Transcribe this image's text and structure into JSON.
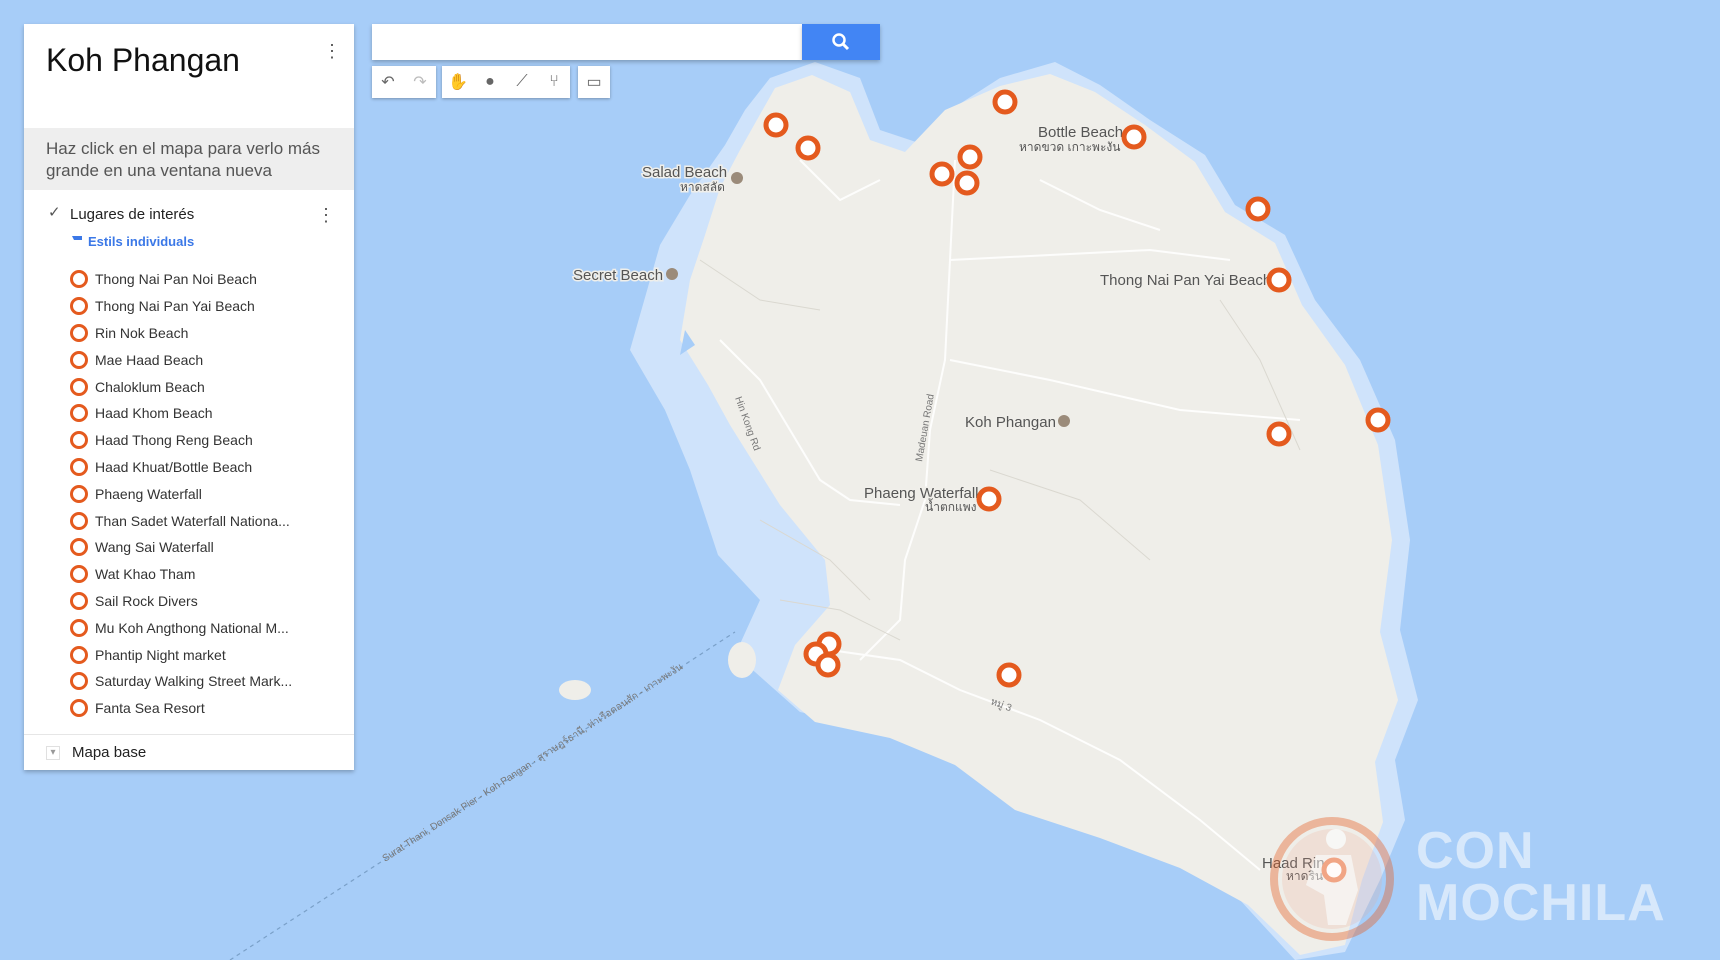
{
  "panel": {
    "title": "Koh Phangan",
    "description": "Haz click en el mapa para verlo más grande en una ventana nueva",
    "layer": {
      "name": "Lugares de interés",
      "checked": true,
      "style_link": "Estils individuals",
      "places": [
        "Thong Nai Pan Noi Beach",
        "Thong Nai Pan Yai Beach",
        "Rin Nok Beach",
        "Mae Haad Beach",
        "Chaloklum Beach",
        "Haad Khom Beach",
        "Haad Thong Reng Beach",
        "Haad Khuat/Bottle Beach",
        "Phaeng Waterfall",
        "Than Sadet Waterfall Nationa...",
        "Wang Sai Waterfall",
        "Wat Khao Tham",
        "Sail Rock Divers",
        "Mu Koh Angthong National M...",
        "Phantip Night market",
        "Saturday Walking Street Mark...",
        "Fanta Sea Resort"
      ]
    },
    "basemap_label": "Mapa base"
  },
  "search": {
    "value": "",
    "placeholder": ""
  },
  "toolbar": [
    "undo-icon",
    "redo-icon",
    "hand-icon",
    "marker-icon",
    "line-icon",
    "directions-icon",
    "ruler-icon"
  ],
  "map": {
    "labels": {
      "salad_beach": "Salad Beach",
      "salad_beach_thai": "หาดสลัด",
      "secret_beach": "Secret Beach",
      "bottle_beach": "Bottle Beach",
      "bottle_beach_thai": "หาดขวด เกาะพะงัน",
      "thong_nai_pan_yai": "Thong Nai Pan Yai Beach",
      "koh_phangan": "Koh Phangan",
      "phaeng_waterfall": "Phaeng Waterfall",
      "phaeng_waterfall_thai": "น้ำตกแพง",
      "haad_rin": "Haad Rin",
      "haad_rin_thai": "หาดริน",
      "road_hin_kong": "Hin Kong Rd",
      "road_madeuan": "Madeuan Road",
      "road_moo3": "หมู่ 3",
      "ferry_route": "Surat Thani, Donsak Pier - Koh Pangan · สุราษฎร์ธานี, ท่าเรือดอนสัก - เกาะพะงัน"
    },
    "colors": {
      "water": "#a7cdf8",
      "land": "#efeee9",
      "shallow": "#d3e6fb",
      "marker": "#e45a1e"
    }
  },
  "watermark": {
    "line1": "CON",
    "line2": "MOCHILA"
  }
}
